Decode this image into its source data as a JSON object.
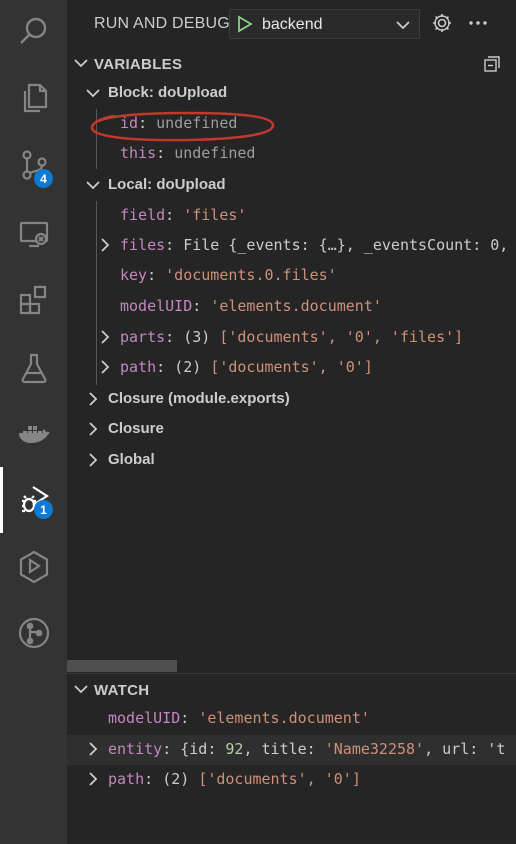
{
  "activity_bar": {
    "items": [
      {
        "icon": "search-icon"
      },
      {
        "icon": "files-icon"
      },
      {
        "icon": "source-control-icon",
        "badge": "4"
      },
      {
        "icon": "remote-explorer-icon"
      },
      {
        "icon": "extensions-icon"
      },
      {
        "icon": "testing-icon"
      },
      {
        "icon": "docker-icon"
      },
      {
        "icon": "run-debug-icon",
        "badge": "1",
        "active": true
      },
      {
        "icon": "deploy-icon"
      },
      {
        "icon": "git-graph-icon"
      }
    ]
  },
  "header": {
    "title": "RUN AND DEBUG",
    "config_name": "backend"
  },
  "variables": {
    "title": "VARIABLES",
    "block_scope": {
      "label": "Block: doUpload",
      "items": [
        {
          "key": "id",
          "value": "undefined"
        },
        {
          "key": "this",
          "value": "undefined"
        }
      ]
    },
    "local_scope": {
      "label": "Local: doUpload",
      "items": [
        {
          "key": "field",
          "value": "'files'"
        },
        {
          "key": "files",
          "value": "File {_events: {…}, _eventsCount: 0,"
        },
        {
          "key": "key",
          "value": "'documents.0.files'"
        },
        {
          "key": "modelUID",
          "value": "'elements.document'"
        },
        {
          "key": "parts",
          "count": "(3)",
          "value": "['documents', '0', 'files']"
        },
        {
          "key": "path",
          "count": "(2)",
          "value": "['documents', '0']"
        }
      ]
    },
    "other_scopes": [
      "Closure (module.exports)",
      "Closure",
      "Global"
    ]
  },
  "watch": {
    "title": "WATCH",
    "items": [
      {
        "key": "modelUID",
        "value": "'elements.document'"
      },
      {
        "key": "entity",
        "value_prefix": "{id: ",
        "id": "92",
        "value_mid": ", title: ",
        "title": "'Name32258'",
        "value_end": ", url: 't"
      },
      {
        "key": "path",
        "count": "(2)",
        "value": "['documents', '0']"
      }
    ]
  },
  "colors": {
    "activity_bg": "#333333",
    "sidebar_bg": "#252526",
    "badge": "#0e7ad3",
    "var_name": "#c586c0",
    "string": "#ce9178",
    "number": "#b5cea8",
    "annotation": "#c0392b"
  }
}
